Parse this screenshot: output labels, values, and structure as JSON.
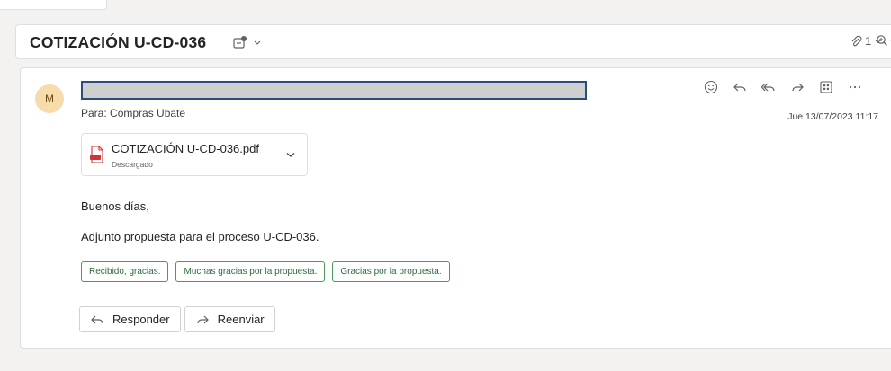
{
  "subject": {
    "title": "COTIZACIÓN U-CD-036",
    "attachment_count": "1"
  },
  "message": {
    "avatar_initial": "M",
    "to_label": "Para:",
    "to_value": "Compras Ubate",
    "date": "Jue 13/07/2023 11:17",
    "attachment": {
      "name": "COTIZACIÓN U-CD-036.pdf",
      "status": "Descargado"
    },
    "greeting": "Buenos días,",
    "body": "Adjunto propuesta para el proceso U-CD-036.",
    "quick_replies": [
      "Recibido, gracias.",
      "Muchas gracias por la propuesta.",
      "Gracias por la propuesta."
    ],
    "reply_label": "Responder",
    "forward_label": "Reenviar"
  },
  "icons": {
    "subject": [
      "tag-icon",
      "chevron-down-icon",
      "paperclip-icon",
      "zoom-icon"
    ],
    "actions": [
      "emoji-icon",
      "reply-icon",
      "reply-all-icon",
      "forward-icon",
      "apps-icon",
      "more-icon"
    ],
    "attachment": "pdf-icon"
  },
  "colors": {
    "avatar_bg": "#f6dcaa",
    "quick_reply_border": "#4a9a5c",
    "pdf_red": "#d13438"
  }
}
